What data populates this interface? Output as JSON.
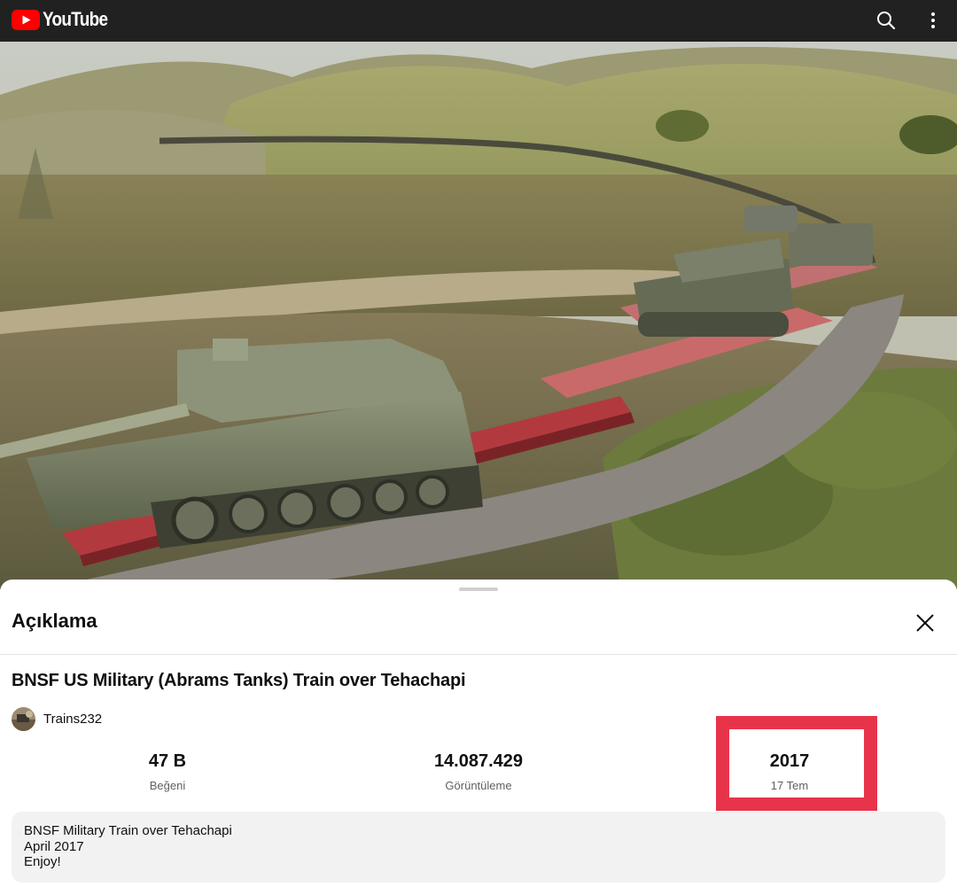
{
  "app": {
    "brand": "YouTube"
  },
  "header": {
    "search_icon": "search-icon",
    "menu_icon": "more-vert-icon"
  },
  "description_panel": {
    "title": "Açıklama",
    "close_icon": "close-icon",
    "video_title": "BNSF US Military (Abrams Tanks) Train over Tehachapi",
    "channel": {
      "name": "Trains232"
    },
    "stats": [
      {
        "value": "47 B",
        "label": "Beğeni"
      },
      {
        "value": "14.087.429",
        "label": "Görüntüleme"
      },
      {
        "value": "2017",
        "label": "17 Tem"
      }
    ],
    "description_lines": [
      "BNSF Military Train over Tehachapi",
      "April 2017",
      "Enjoy!"
    ]
  },
  "colors": {
    "topbar": "#212121",
    "brand_red": "#ff0000",
    "highlight": "#e8344a",
    "desc_bg": "#f2f2f2"
  }
}
